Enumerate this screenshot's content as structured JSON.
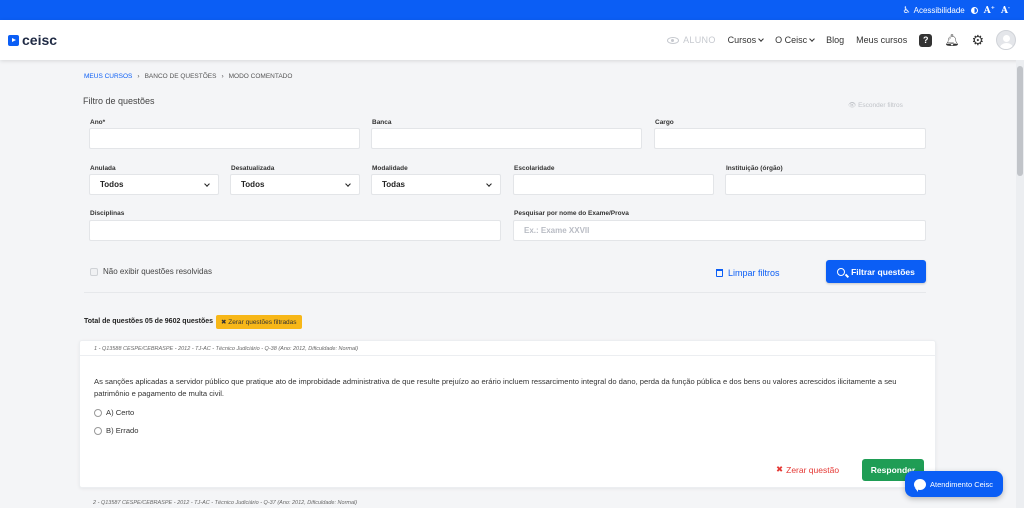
{
  "topbar": {
    "accessibility_label": "Acessibilidade",
    "font_up_label": "A",
    "font_up_sup": "+",
    "font_down_label": "A",
    "font_down_sup": "-"
  },
  "header": {
    "logo_text": "ceisc",
    "role_label": "ALUNO",
    "nav": {
      "cursos": "Cursos",
      "o_ceisc": "O Ceisc",
      "blog": "Blog",
      "meus_cursos": "Meus cursos"
    }
  },
  "breadcrumb": [
    "MEUS CURSOS",
    "BANCO DE QUESTÕES",
    "MODO COMENTADO"
  ],
  "breadcrumb_separator": "›",
  "filters": {
    "title": "Filtro de questões",
    "hide_label": "Esconder filtros",
    "ano_label": "Ano*",
    "banca_label": "Banca",
    "cargo_label": "Cargo",
    "anulada_label": "Anulada",
    "anulada_value": "Todos",
    "desatualizada_label": "Desatualizada",
    "desatualizada_value": "Todos",
    "modalidade_label": "Modalidade",
    "modalidade_value": "Todas",
    "escolaridade_label": "Escolaridade",
    "instituicao_label": "Instituição (órgão)",
    "disciplinas_label": "Disciplinas",
    "exam_search_label": "Pesquisar por nome do Exame/Prova",
    "exam_search_placeholder": "Ex.: Exame XXVII",
    "hide_resolved_label": "Não exibir questões resolvidas",
    "clear_label": "Limpar filtros",
    "filter_button": "Filtrar questões"
  },
  "results": {
    "total_label": "Total de questões 05 de 9602 questões",
    "reset_tag": "✖ Zerar questões filtradas"
  },
  "questions": [
    {
      "meta": "1 - Q13588 CESPE/CEBRASPE - 2012 - TJ-AC - Técnico Judiciário - Q-38 (Ano: 2012, Dificuldade: Normal)",
      "text": "As sanções aplicadas a servidor público que pratique ato de improbidade administrativa de que resulte prejuízo ao erário incluem ressarcimento integral do dano, perda da função pública e dos bens ou valores acrescidos ilicitamente a seu patrimônio e pagamento de multa civil.",
      "options": [
        "A) Certo",
        "B) Errado"
      ],
      "zero_label": "Zerar questão",
      "answer_label": "Responder"
    },
    {
      "meta": "2 - Q13587 CESPE/CEBRASPE - 2012 - TJ-AC - Técnico Judiciário - Q-37 (Ano: 2012, Dificuldade: Normal)"
    }
  ],
  "chat": {
    "label": "Atendimento Ceisc"
  }
}
